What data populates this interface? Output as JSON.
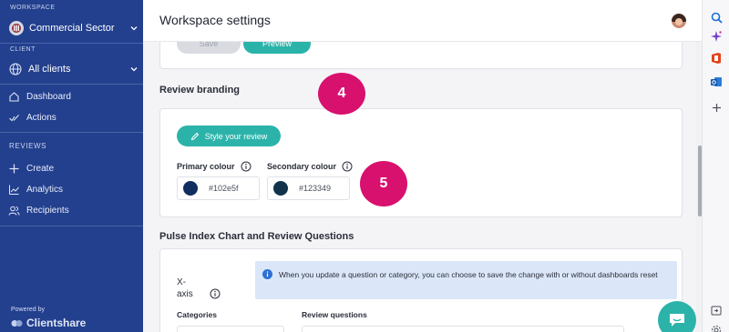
{
  "sidebar": {
    "workspace_label": "WORKSPACE",
    "workspace_name": "Commercial Sector",
    "client_label": "CLIENT",
    "client_value": "All clients",
    "nav": [
      {
        "label": "Dashboard",
        "icon": "home-icon"
      },
      {
        "label": "Actions",
        "icon": "check-icon"
      }
    ],
    "reviews_label": "REVIEWS",
    "reviews_nav": [
      {
        "label": "Create",
        "icon": "plus-icon"
      },
      {
        "label": "Analytics",
        "icon": "analytics-icon"
      },
      {
        "label": "Recipients",
        "icon": "recipients-icon"
      }
    ],
    "powered_by": "Powered by",
    "brand": "Clientshare"
  },
  "header": {
    "title": "Workspace settings"
  },
  "top_card": {
    "save_label": "Save",
    "preview_label": "Preview"
  },
  "branding": {
    "section_title": "Review branding",
    "style_button": "Style your review",
    "primary_label": "Primary colour",
    "primary_hex": "#102e5f",
    "secondary_label": "Secondary colour",
    "secondary_hex": "#123349"
  },
  "pulse": {
    "section_title": "Pulse Index Chart and Review Questions",
    "xaxis_label": "X-axis",
    "info_text": "When you update a question or category, you can choose to save the change with or without dashboards reset",
    "categories_header": "Categories",
    "questions_header": "Review questions"
  },
  "badges": {
    "step_4": "4",
    "step_5": "5"
  },
  "colors": {
    "sidebar_bg": "#23408e",
    "accent_teal": "#2bb3aa",
    "badge_magenta": "#d8106e"
  }
}
